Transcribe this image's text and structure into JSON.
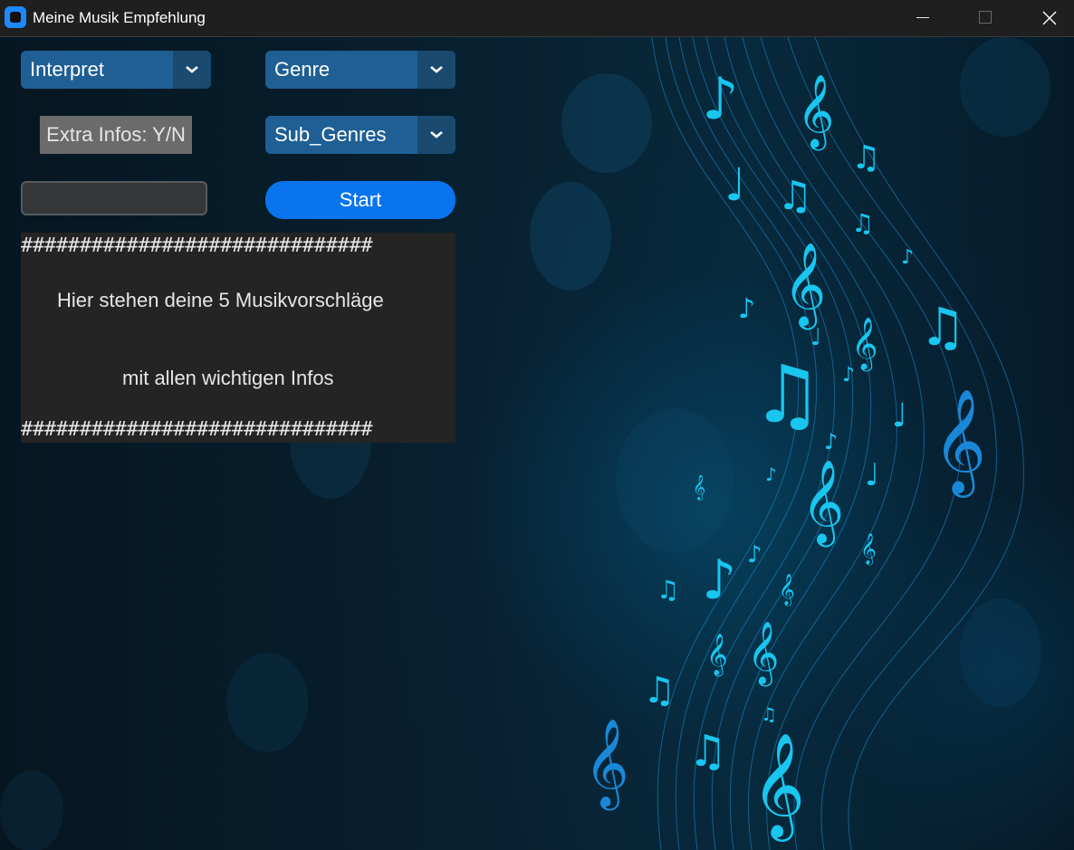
{
  "window": {
    "title": "Meine Musik Empfehlung",
    "icon": "app-icon",
    "controls": [
      "minimize-icon",
      "maximize-icon",
      "close-icon"
    ]
  },
  "controls": {
    "interpret_select": {
      "value": "Interpret",
      "icon": "chevron-down-icon"
    },
    "genre_select": {
      "value": "Genre",
      "icon": "chevron-down-icon"
    },
    "subgenre_select": {
      "value": "Sub_Genres",
      "icon": "chevron-down-icon"
    },
    "extra_info_label": "Extra Infos: Y/N",
    "extra_info_input": {
      "value": "",
      "placeholder": ""
    },
    "start_button": "Start"
  },
  "output": {
    "separator_top": "##############################",
    "line1": "Hier stehen deine 5 Musikvorschläge",
    "line2": "mit allen wichtigen Infos",
    "separator_bottom": "##############################"
  },
  "colors": {
    "titlebar": "#1f1f1f",
    "combo": "#1f5f94",
    "combo_arrow": "#1a4a70",
    "start_button": "#0a74ef",
    "textbox": "#242424",
    "accent_glow": "#00d8ff"
  },
  "background": {
    "icon": "music-notes-background"
  }
}
